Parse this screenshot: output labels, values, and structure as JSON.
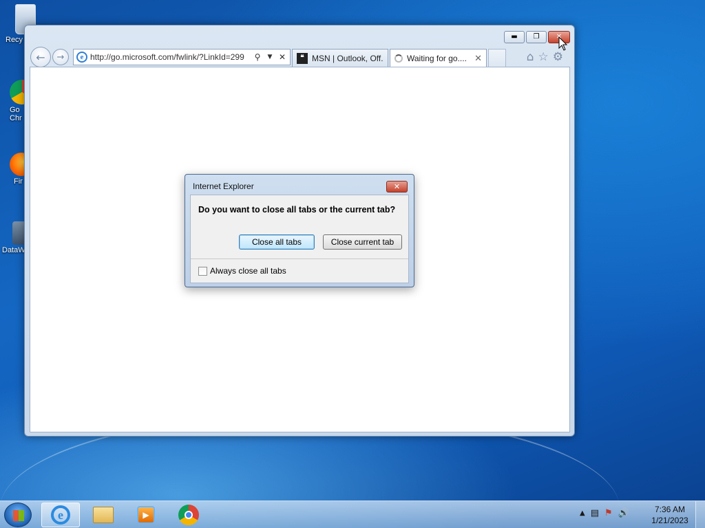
{
  "desktop": {
    "icons": [
      {
        "label": "Recy"
      },
      {
        "label": "Go Chr"
      },
      {
        "label": "Fir"
      },
      {
        "label": "DataW"
      }
    ]
  },
  "browser": {
    "window_buttons": {
      "minimize": "minimize",
      "restore": "restore",
      "close": "close"
    },
    "address": {
      "url": "http://go.microsoft.com/fwlink/?LinkId=299"
    },
    "tabs": [
      {
        "title": "MSN | Outlook, Off..."
      },
      {
        "title": "Waiting for go...."
      }
    ]
  },
  "dialog": {
    "title": "Internet Explorer",
    "question": "Do you want to close all tabs or the current tab?",
    "buttons": {
      "close_all": "Close all tabs",
      "close_current": "Close current tab"
    },
    "checkbox": {
      "label": "Always close all tabs",
      "checked": false
    }
  },
  "taskbar": {
    "items": [
      "internet-explorer",
      "windows-explorer",
      "windows-media-player",
      "google-chrome"
    ],
    "clock": {
      "time": "7:36 AM",
      "date": "1/21/2023"
    }
  },
  "colors": {
    "desktop_blue": "#1467c2",
    "close_red": "#c6432d",
    "dialog_frame": "#bdd0e7"
  }
}
